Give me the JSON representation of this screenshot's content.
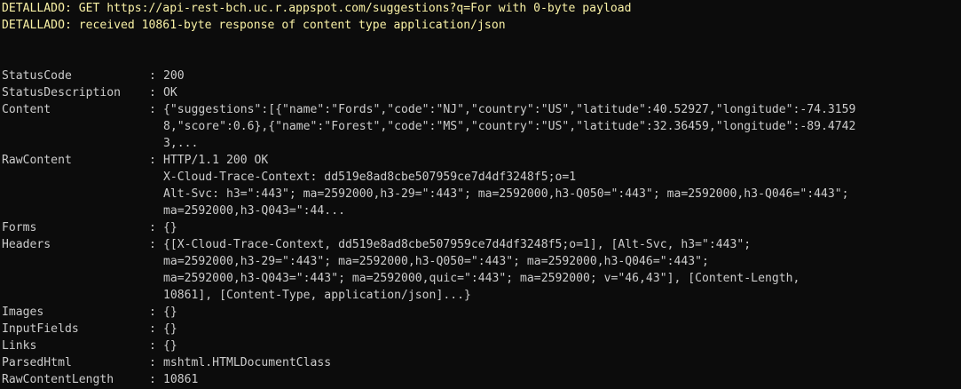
{
  "verbose": {
    "line1": "DETALLADO: GET https://api-rest-bch.uc.r.appspot.com/suggestions?q=For with 0-byte payload",
    "line2": "DETALLADO: received 10861-byte response of content type application/json"
  },
  "separator": ": ",
  "fields": [
    {
      "key": "StatusCode",
      "lines": [
        "200"
      ]
    },
    {
      "key": "StatusDescription",
      "lines": [
        "OK"
      ]
    },
    {
      "key": "Content",
      "lines": [
        "{\"suggestions\":[{\"name\":\"Fords\",\"code\":\"NJ\",\"country\":\"US\",\"latitude\":40.52927,\"longitude\":-74.3159",
        "8,\"score\":0.6},{\"name\":\"Forest\",\"code\":\"MS\",\"country\":\"US\",\"latitude\":32.36459,\"longitude\":-89.4742",
        "3,..."
      ]
    },
    {
      "key": "RawContent",
      "lines": [
        "HTTP/1.1 200 OK",
        "X-Cloud-Trace-Context: dd519e8ad8cbe507959ce7d4df3248f5;o=1",
        "Alt-Svc: h3=\":443\"; ma=2592000,h3-29=\":443\"; ma=2592000,h3-Q050=\":443\"; ma=2592000,h3-Q046=\":443\";",
        "ma=2592000,h3-Q043=\":44..."
      ]
    },
    {
      "key": "Forms",
      "lines": [
        "{}"
      ]
    },
    {
      "key": "Headers",
      "lines": [
        "{[X-Cloud-Trace-Context, dd519e8ad8cbe507959ce7d4df3248f5;o=1], [Alt-Svc, h3=\":443\";",
        "ma=2592000,h3-29=\":443\"; ma=2592000,h3-Q050=\":443\"; ma=2592000,h3-Q046=\":443\";",
        "ma=2592000,h3-Q043=\":443\"; ma=2592000,quic=\":443\"; ma=2592000; v=\"46,43\"], [Content-Length,",
        "10861], [Content-Type, application/json]...}"
      ]
    },
    {
      "key": "Images",
      "lines": [
        "{}"
      ]
    },
    {
      "key": "InputFields",
      "lines": [
        "{}"
      ]
    },
    {
      "key": "Links",
      "lines": [
        "{}"
      ]
    },
    {
      "key": "ParsedHtml",
      "lines": [
        "mshtml.HTMLDocumentClass"
      ]
    },
    {
      "key": "RawContentLength",
      "lines": [
        "10861"
      ]
    }
  ],
  "colors": {
    "background": "#0c0c0c",
    "text": "#cccccc",
    "verbose": "#f9f1a5"
  }
}
